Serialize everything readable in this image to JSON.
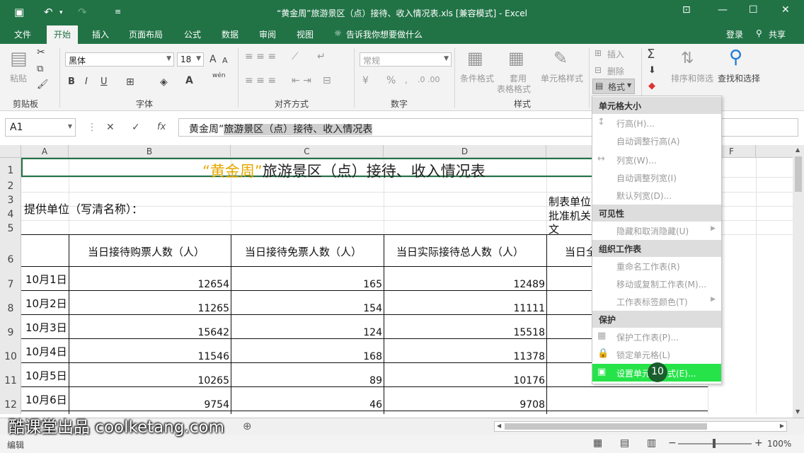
{
  "window": {
    "title": "“黄金周”旅游景区（点）接待、收入情况表.xls  [兼容模式] - Excel",
    "login": "登录",
    "share": "共享"
  },
  "tabs": [
    "文件",
    "开始",
    "插入",
    "页面布局",
    "公式",
    "数据",
    "审阅",
    "视图"
  ],
  "tell_me": "告诉我你想要做什么",
  "ribbon": {
    "clipboard": {
      "paste": "粘贴",
      "label": "剪贴板"
    },
    "font": {
      "name": "黑体",
      "size": "18",
      "label": "字体",
      "bold": "B",
      "italic": "I",
      "underline": "U",
      "grow": "A",
      "shrink": "A",
      "font_color": "A",
      "wen": "wén"
    },
    "alignment": {
      "label": "对齐方式"
    },
    "number": {
      "format": "常规",
      "label": "数字",
      "percent": "%"
    },
    "styles": {
      "conditional": "条件格式",
      "table_line1": "套用",
      "table_line2": "表格格式",
      "cell_styles": "单元格样式",
      "label": "样式"
    },
    "cells": {
      "insert": "插入",
      "delete": "删除",
      "format": "格式"
    },
    "editing": {
      "sort": "排序和筛选",
      "find": "查找和选择"
    }
  },
  "formula_bar": {
    "name_box": "A1",
    "fx": "fx",
    "prefix": "黄金周”",
    "selected": "旅游景区（点）接待、收入情况表"
  },
  "columns": [
    "A",
    "B",
    "C",
    "D",
    "F"
  ],
  "rows": [
    "1",
    "2",
    "3",
    "4",
    "5",
    "6",
    "7",
    "8",
    "9",
    "10",
    "11",
    "12"
  ],
  "sheet": {
    "title_gold": "“黄金周”",
    "title_rest": "旅游景区（点）接待、收入情况表",
    "provider": "提供单位（写清名称）：",
    "maker": "制表单位",
    "approver": "批准机关",
    "wen": "文",
    "headers": [
      "当日接待购票人数（人）",
      "当日接待免票人数（人）",
      "当日实际接待总人数（人）",
      "当日全"
    ],
    "data": [
      {
        "date": "10月1日",
        "paid": "12654",
        "free": "165",
        "total": "12489"
      },
      {
        "date": "10月2日",
        "paid": "11265",
        "free": "154",
        "total": "11111"
      },
      {
        "date": "10月3日",
        "paid": "15642",
        "free": "124",
        "total": "15518"
      },
      {
        "date": "10月4日",
        "paid": "11546",
        "free": "168",
        "total": "11378"
      },
      {
        "date": "10月5日",
        "paid": "10265",
        "free": "89",
        "total": "10176"
      },
      {
        "date": "10月6日",
        "paid": "9754",
        "free": "46",
        "total": "9708"
      }
    ]
  },
  "menu": {
    "sections": {
      "cell_size": "单元格大小",
      "visibility": "可见性",
      "organize": "组织工作表",
      "protect": "保护"
    },
    "items": {
      "row_height": "行高(H)...",
      "autofit_row": "自动调整行高(A)",
      "col_width": "列宽(W)...",
      "autofit_col": "自动调整列宽(I)",
      "default_width": "默认列宽(D)...",
      "hide_unhide": "隐藏和取消隐藏(U)",
      "rename": "重命名工作表(R)",
      "move_copy": "移动或复制工作表(M)...",
      "tab_color": "工作表标签颜色(T)",
      "protect_sheet": "保护工作表(P)...",
      "lock_cell": "锁定单元格(L)",
      "format_cells": "设置单元格格式(E)..."
    }
  },
  "badge": "10",
  "status": {
    "mode": "编辑",
    "zoom": "100%"
  },
  "watermark": "酷课堂出品 coolketang.com"
}
